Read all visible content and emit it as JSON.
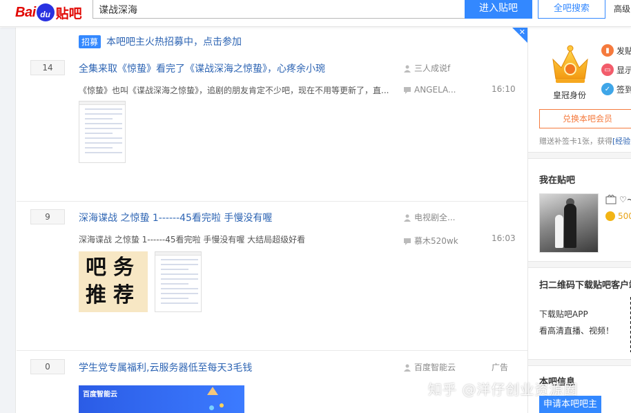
{
  "header": {
    "logo_bai": "Bai",
    "logo_du": "du",
    "logo_tieba": "贴吧",
    "search_value": "谍战深海",
    "enter_button": "进入贴吧",
    "search_all_button": "全吧搜索",
    "advanced_link": "高级"
  },
  "recruit": {
    "tag": "招募",
    "text": "本吧吧主火热招募中，点击参加"
  },
  "threads": [
    {
      "reply_count": "14",
      "title": "全集来取《惊蛰》看完了《谍战深海之惊蛰》，心疼余小琬",
      "abstract": "《惊蛰》也叫《谍战深海之惊蛰》，追剧的朋友肯定不少吧，现在不用等更新了，直...",
      "author": "三人成说f",
      "last_replier": "ANGELA...",
      "time": "16:10"
    },
    {
      "reply_count": "9",
      "title": "深海谍战 之惊蛰 1------45看完啦 手慢没有喔",
      "abstract": "深海谍战 之惊蛰 1------45看完啦 手慢没有喔 大结局超级好看",
      "author": "电视剧全...",
      "last_replier": "慕木520wk",
      "time": "16:03",
      "image_text": [
        "吧务",
        "推荐"
      ]
    },
    {
      "reply_count": "0",
      "title": "学生党专属福利,云服务器低至每天3毛钱",
      "author": "百度智能云",
      "tag": "广告",
      "ad_logo": "百度智能云"
    }
  ],
  "sidebar": {
    "crown_label": "皇冠身份",
    "actions": [
      {
        "icon": "bookmark-icon",
        "label": "发贴",
        "color": "#f57a3d"
      },
      {
        "icon": "display-icon",
        "label": "显示",
        "color": "#f25c6b"
      },
      {
        "icon": "sign-in-icon",
        "label": "签到",
        "color": "#3fa6e8"
      }
    ],
    "exchange_button": "兑换本吧会员",
    "note_prefix": "赠送补签卡1张，获得",
    "note_link": "[经验",
    "my_tieba_heading": "我在贴吧",
    "level_text": "♡~",
    "coins_text": "500",
    "qr_heading": "扫二维码下载贴吧客户端",
    "download_text": "下载贴吧APP",
    "download_sub": "看高清直播、视频！",
    "bar_info_heading": "本吧信息",
    "apply_button": "申请本吧吧主"
  },
  "watermark": "知乎 @洋仔创业资源圈",
  "colors": {
    "brand_red": "#e10601",
    "brand_blue": "#2932e1",
    "accent_blue": "#3388ff",
    "link_blue": "#2d64b3",
    "orange": "#f57a3d"
  }
}
